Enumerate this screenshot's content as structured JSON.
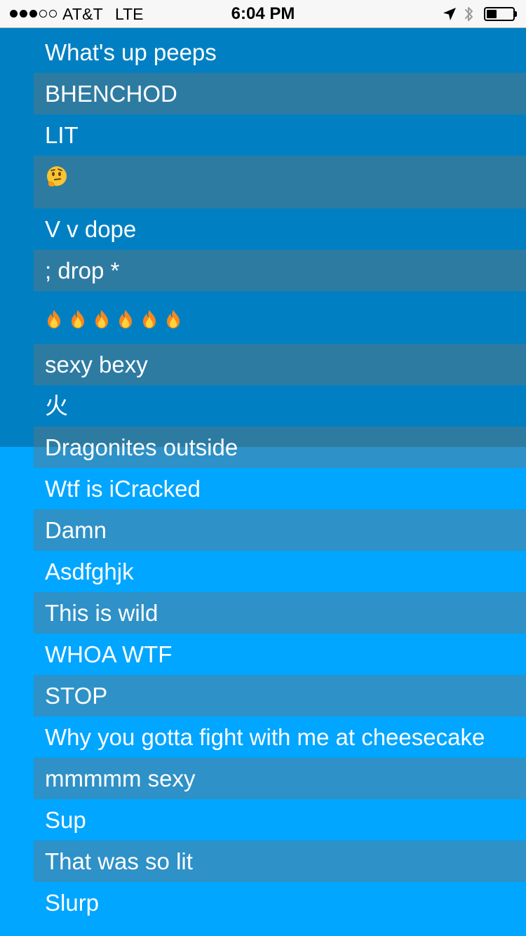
{
  "status_bar": {
    "carrier": "AT&T",
    "network": "LTE",
    "time": "6:04 PM",
    "signal_bars_filled": 3,
    "signal_bars_total": 5,
    "battery_level": 0.4,
    "icons": [
      "location-arrow-icon",
      "bluetooth-icon",
      "battery-icon"
    ]
  },
  "messages": [
    {
      "text": "What's up peeps"
    },
    {
      "text": "BHENCHOD"
    },
    {
      "text": "LIT"
    },
    {
      "text": "🤔",
      "emoji": "thinking-face"
    },
    {
      "text": "V v dope"
    },
    {
      "text": "; drop *"
    },
    {
      "text": "🔥🔥🔥🔥🔥🔥",
      "emoji": "fire",
      "count": 6
    },
    {
      "text": "sexy bexy"
    },
    {
      "text": "火"
    },
    {
      "text": "Dragonites outside"
    },
    {
      "text": "Wtf is iCracked"
    },
    {
      "text": "Damn"
    },
    {
      "text": "Asdfghjk"
    },
    {
      "text": "This is wild"
    },
    {
      "text": "WHOA WTF"
    },
    {
      "text": "STOP"
    },
    {
      "text": "Why you gotta fight with me at cheesecake"
    },
    {
      "text": "mmmmm sexy"
    },
    {
      "text": "Sup"
    },
    {
      "text": "That was so lit"
    },
    {
      "text": "Slurp"
    }
  ],
  "colors": {
    "background": "#00a6ff",
    "dark_panel": "#0080c2",
    "row_shade": "rgba(115,115,115,0.4)",
    "text": "#ffffff"
  }
}
